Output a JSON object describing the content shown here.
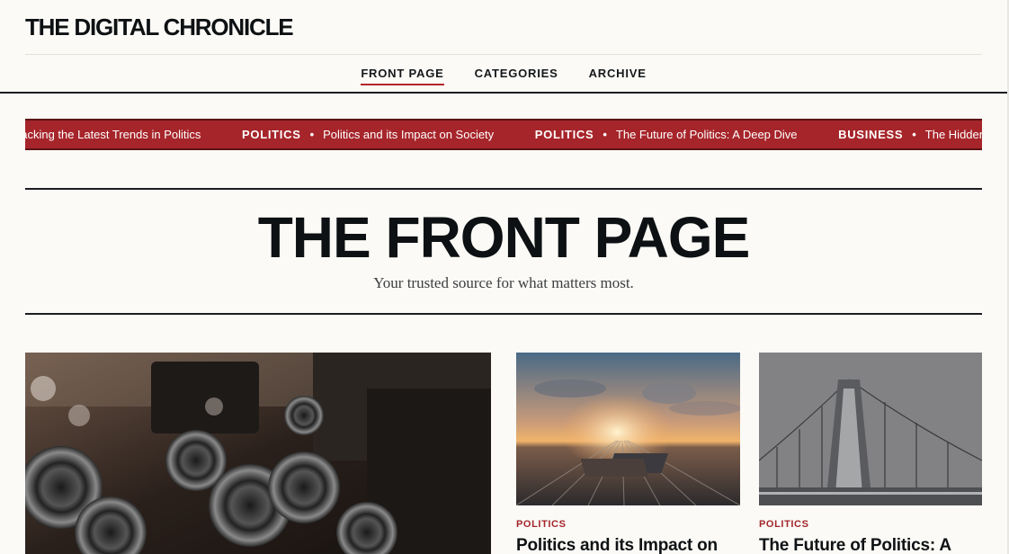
{
  "masthead": {
    "logo": "THE DIGITAL CHRONICLE"
  },
  "nav": {
    "items": [
      {
        "label": "FRONT PAGE",
        "active": true
      },
      {
        "label": "CATEGORIES",
        "active": false
      },
      {
        "label": "ARCHIVE",
        "active": false
      }
    ]
  },
  "ticker": {
    "lead_title": "packing the Latest Trends in Politics",
    "items": [
      {
        "category": "POLITICS",
        "title": "Politics and its Impact on Society"
      },
      {
        "category": "POLITICS",
        "title": "The Future of Politics: A Deep Dive"
      },
      {
        "category": "BUSINESS",
        "title": "The Hidden"
      }
    ],
    "separator": "•"
  },
  "hero": {
    "title": "THE FRONT PAGE",
    "subtitle": "Your trusted source for what matters most."
  },
  "articles": [
    {
      "image": "vintage-cameras-photo"
    },
    {
      "image": "railway-sunset-photo",
      "category": "POLITICS",
      "title": "Politics and its Impact on"
    },
    {
      "image": "bridge-aerial-photo",
      "category": "POLITICS",
      "title": "The Future of Politics: A"
    }
  ],
  "colors": {
    "accent": "#a6252a",
    "background": "#fbfaf6",
    "text": "#121416"
  }
}
